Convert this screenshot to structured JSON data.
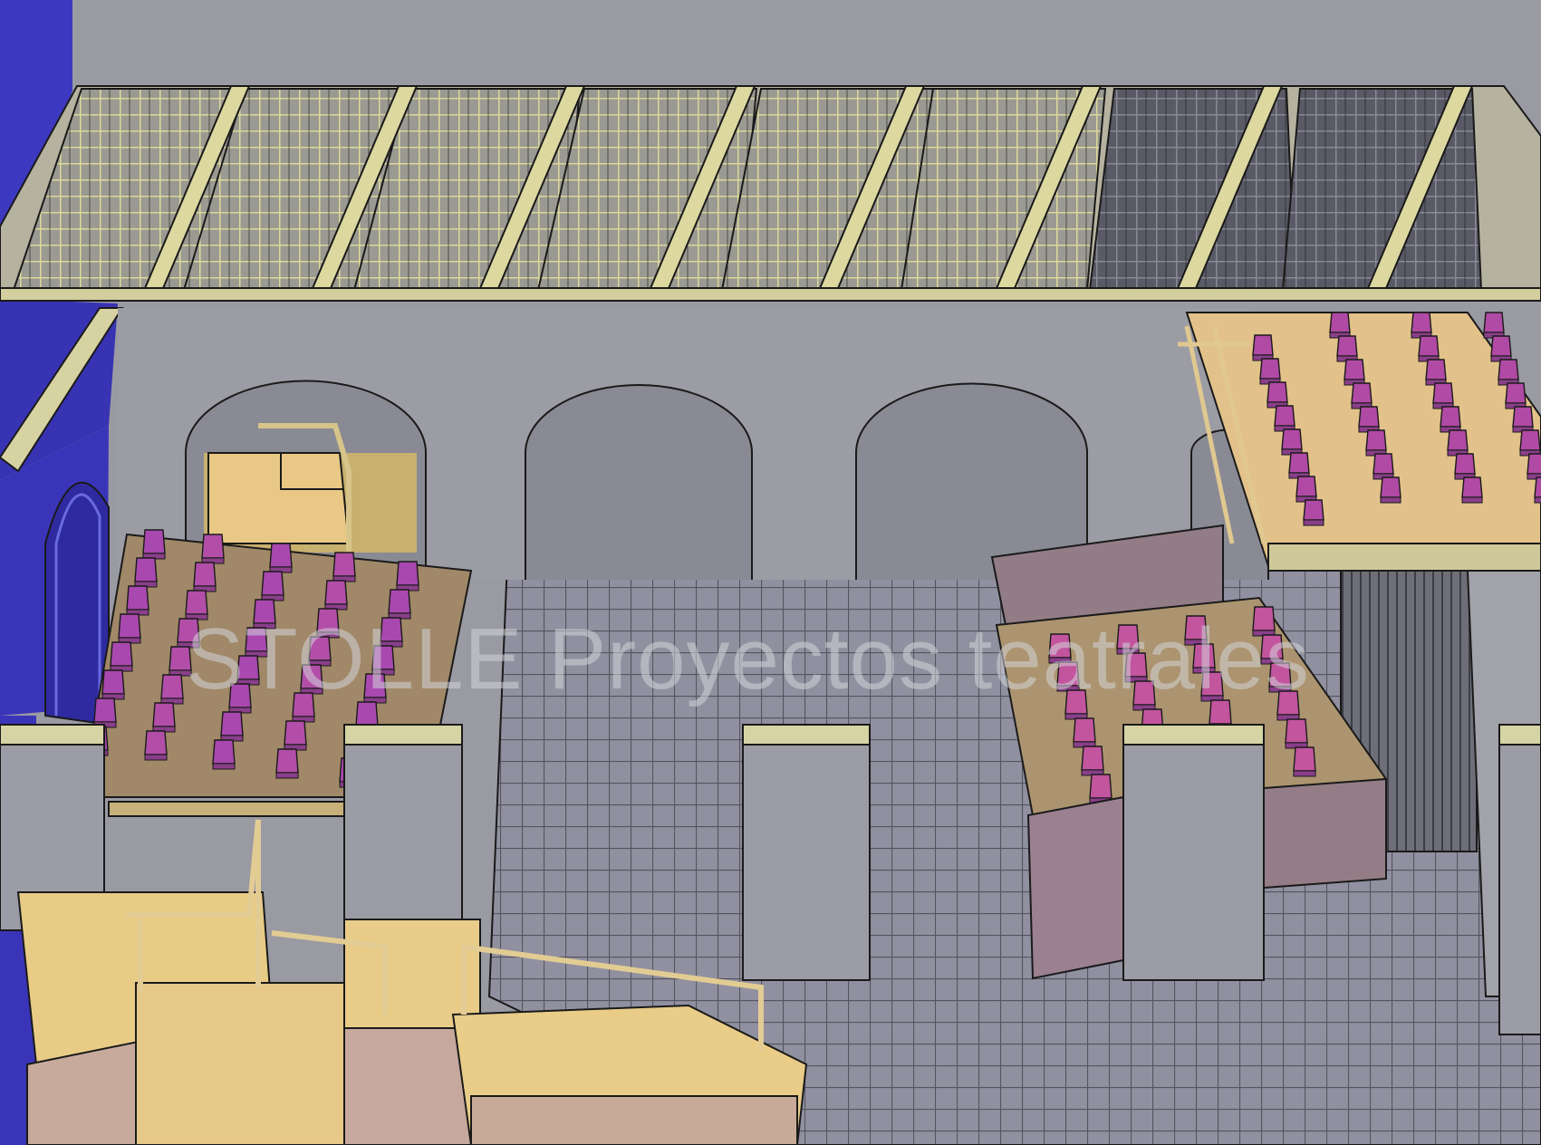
{
  "watermark": {
    "text": "STOLLE Proyectos teatrales"
  },
  "colors": {
    "background": "#8f8f98",
    "wall_gray": "#9a9aa2",
    "wall_blue": "#3a35b8",
    "grid_cream": "#d8d498",
    "grid_dark": "#6c6c78",
    "platform_cream": "#e6cc88",
    "platform_shadow": "#c4a89a",
    "seat_magenta": "#b74fb0",
    "seat_pink": "#cc5aa6",
    "riser_tan": "#b0986e",
    "floor_gray": "#8f8f99",
    "floor_line": "#5e5e6a",
    "outline": "#1a1a1a",
    "pillar_cap": "#d4d2a0"
  }
}
